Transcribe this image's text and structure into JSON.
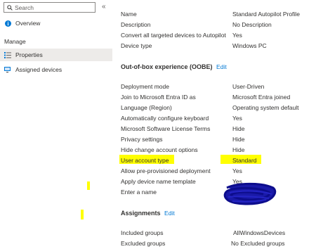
{
  "sidebar": {
    "search_placeholder": "Search",
    "collapse_glyph": "«",
    "overview_label": "Overview",
    "manage_label": "Manage",
    "properties_label": "Properties",
    "assigned_devices_label": "Assigned devices",
    "overview_icon": "info-icon",
    "properties_icon": "properties-icon",
    "assigned_devices_icon": "devices-icon"
  },
  "basics": [
    {
      "key": "Name",
      "value": "Standard Autopilot Profile"
    },
    {
      "key": "Description",
      "value": "No Description"
    },
    {
      "key": "Convert all targeted devices to Autopilot",
      "value": "Yes"
    },
    {
      "key": "Device type",
      "value": "Windows PC"
    }
  ],
  "oobe": {
    "title": "Out-of-box experience (OOBE)",
    "edit_label": "Edit",
    "rows": [
      {
        "key": "Deployment mode",
        "value": "User-Driven"
      },
      {
        "key": "Join to Microsoft Entra ID as",
        "value": "Microsoft Entra joined"
      },
      {
        "key": "Language (Region)",
        "value": "Operating system default"
      },
      {
        "key": "Automatically configure keyboard",
        "value": "Yes"
      },
      {
        "key": "Microsoft Software License Terms",
        "value": "Hide"
      },
      {
        "key": "Privacy settings",
        "value": "Hide"
      },
      {
        "key": "Hide change account options",
        "value": "Hide"
      },
      {
        "key": "User account type",
        "value": "Standard"
      },
      {
        "key": "Allow pre-provisioned deployment",
        "value": "Yes"
      },
      {
        "key": "Apply device name template",
        "value": "Yes"
      },
      {
        "key": "Enter a name",
        "value": ""
      }
    ]
  },
  "assignments": {
    "title": "Assignments",
    "edit_label": "Edit",
    "rows": [
      {
        "key": "Included groups",
        "value": "AllWindowsDevices"
      },
      {
        "key": "Excluded groups",
        "value": "No Excluded groups"
      }
    ]
  },
  "colors": {
    "link": "#0078d4",
    "highlight": "#ffff00",
    "redaction": "#1a1aa8",
    "selected_bg": "#edebe9"
  }
}
